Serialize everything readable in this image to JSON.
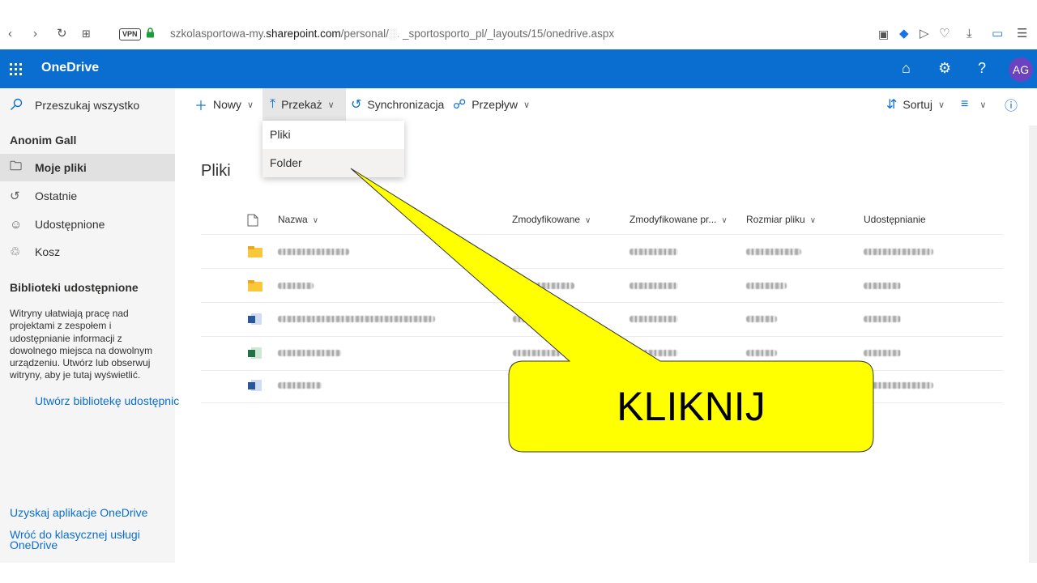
{
  "browser": {
    "url_host": "szkolasportowa-my.",
    "url_domain": "sharepoint.com",
    "url_path": "/personal/",
    "url_path2": "_sportosporto_pl/_layouts/15/onedrive.aspx",
    "vpn_label": "VPN"
  },
  "header": {
    "app_name": "OneDrive",
    "avatar_initials": "AG",
    "help_label": "?"
  },
  "search": {
    "placeholder": "Przeszukaj wszystko"
  },
  "commands": {
    "new_label": "Nowy",
    "upload_label": "Przekaż",
    "sync_label": "Synchronizacja",
    "flow_label": "Przepływ",
    "sort_label": "Sortuj"
  },
  "upload_menu": {
    "items": [
      "Pliki",
      "Folder"
    ]
  },
  "sidebar": {
    "user_name": "Anonim Gall",
    "items": [
      {
        "label": "Moje pliki",
        "icon": "folder-icon"
      },
      {
        "label": "Ostatnie",
        "icon": "history-icon"
      },
      {
        "label": "Udostępnione",
        "icon": "people-icon"
      },
      {
        "label": "Kosz",
        "icon": "trash-icon"
      }
    ],
    "libraries_heading": "Biblioteki udostępnione",
    "libraries_description": "Witryny ułatwiają pracę nad projektami z zespołem i udostępnianie informacji z dowolnego miejsca na dowolnym urządzeniu. Utwórz lub obserwuj witryny, aby je tutaj wyświetlić.",
    "create_library_link": "Utwórz bibliotekę udostępnic",
    "get_app_link": "Uzyskaj aplikacje OneDrive",
    "classic_link": "Wróć do klasycznej usługi OneDrive"
  },
  "main": {
    "title": "Pliki",
    "columns": [
      "Nazwa",
      "Zmodyfikowane",
      "Zmodyfikowane pr...",
      "Rozmiar pliku",
      "Udostępnianie"
    ]
  },
  "callout": {
    "text": "KLIKNIJ",
    "color": "#ffff00"
  },
  "colors": {
    "brand": "#0a6ed1",
    "avatar": "#6b43c0"
  }
}
